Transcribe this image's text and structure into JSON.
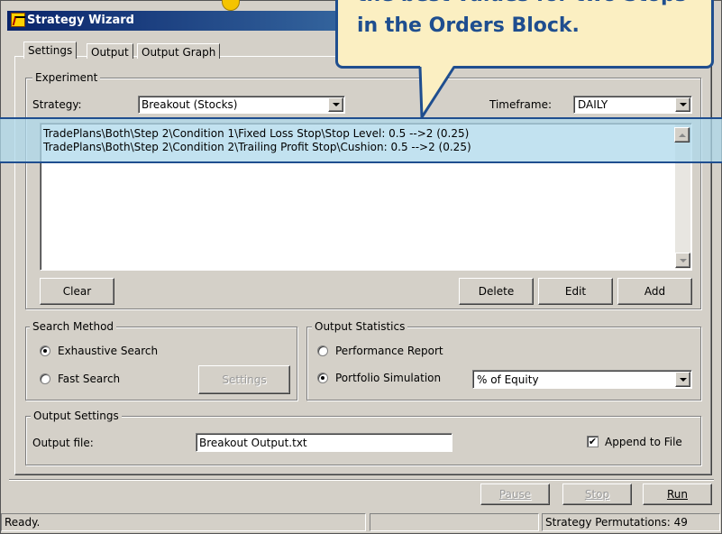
{
  "window": {
    "title": "Strategy Wizard"
  },
  "callout": {
    "line1": "the best values for two Stops",
    "line2": "in the Orders Block."
  },
  "tabs": [
    {
      "label": "Settings"
    },
    {
      "label": "Output"
    },
    {
      "label": "Output Graph"
    }
  ],
  "experiment": {
    "group_label": "Experiment",
    "strategy_label": "Strategy:",
    "strategy_value": "Breakout (Stocks)",
    "timeframe_label": "Timeframe:",
    "timeframe_value": "DAILY",
    "list_items": [
      "TradePlans\\Both\\Step 2\\Condition 1\\Fixed Loss Stop\\Stop Level: 0.5 -->2 (0.25)",
      "TradePlans\\Both\\Step 2\\Condition 2\\Trailing Profit Stop\\Cushion: 0.5 -->2 (0.25)"
    ],
    "buttons": {
      "clear": "Clear",
      "delete": "Delete",
      "edit": "Edit",
      "add": "Add"
    }
  },
  "search_method": {
    "group_label": "Search Method",
    "exhaustive_label": "Exhaustive Search",
    "fast_label": "Fast Search",
    "settings_button": "Settings",
    "selected": "Exhaustive Search"
  },
  "output_statistics": {
    "group_label": "Output Statistics",
    "performance_label": "Performance Report",
    "portfolio_label": "Portfolio Simulation",
    "portfolio_mode_value": "% of Equity",
    "selected": "Portfolio Simulation"
  },
  "output_settings": {
    "group_label": "Output Settings",
    "file_label": "Output file:",
    "file_value": "Breakout Output.txt",
    "append_label": "Append to File",
    "append_checked": true
  },
  "actions": {
    "pause": "Pause",
    "stop": "Stop",
    "run": "Run"
  },
  "status": {
    "left": "Ready.",
    "middle": "",
    "right": "Strategy Permutations: 49"
  },
  "colors": {
    "callout_border": "#1f4e8f",
    "callout_bg": "#fbefc2",
    "highlight": "#add8eb"
  }
}
